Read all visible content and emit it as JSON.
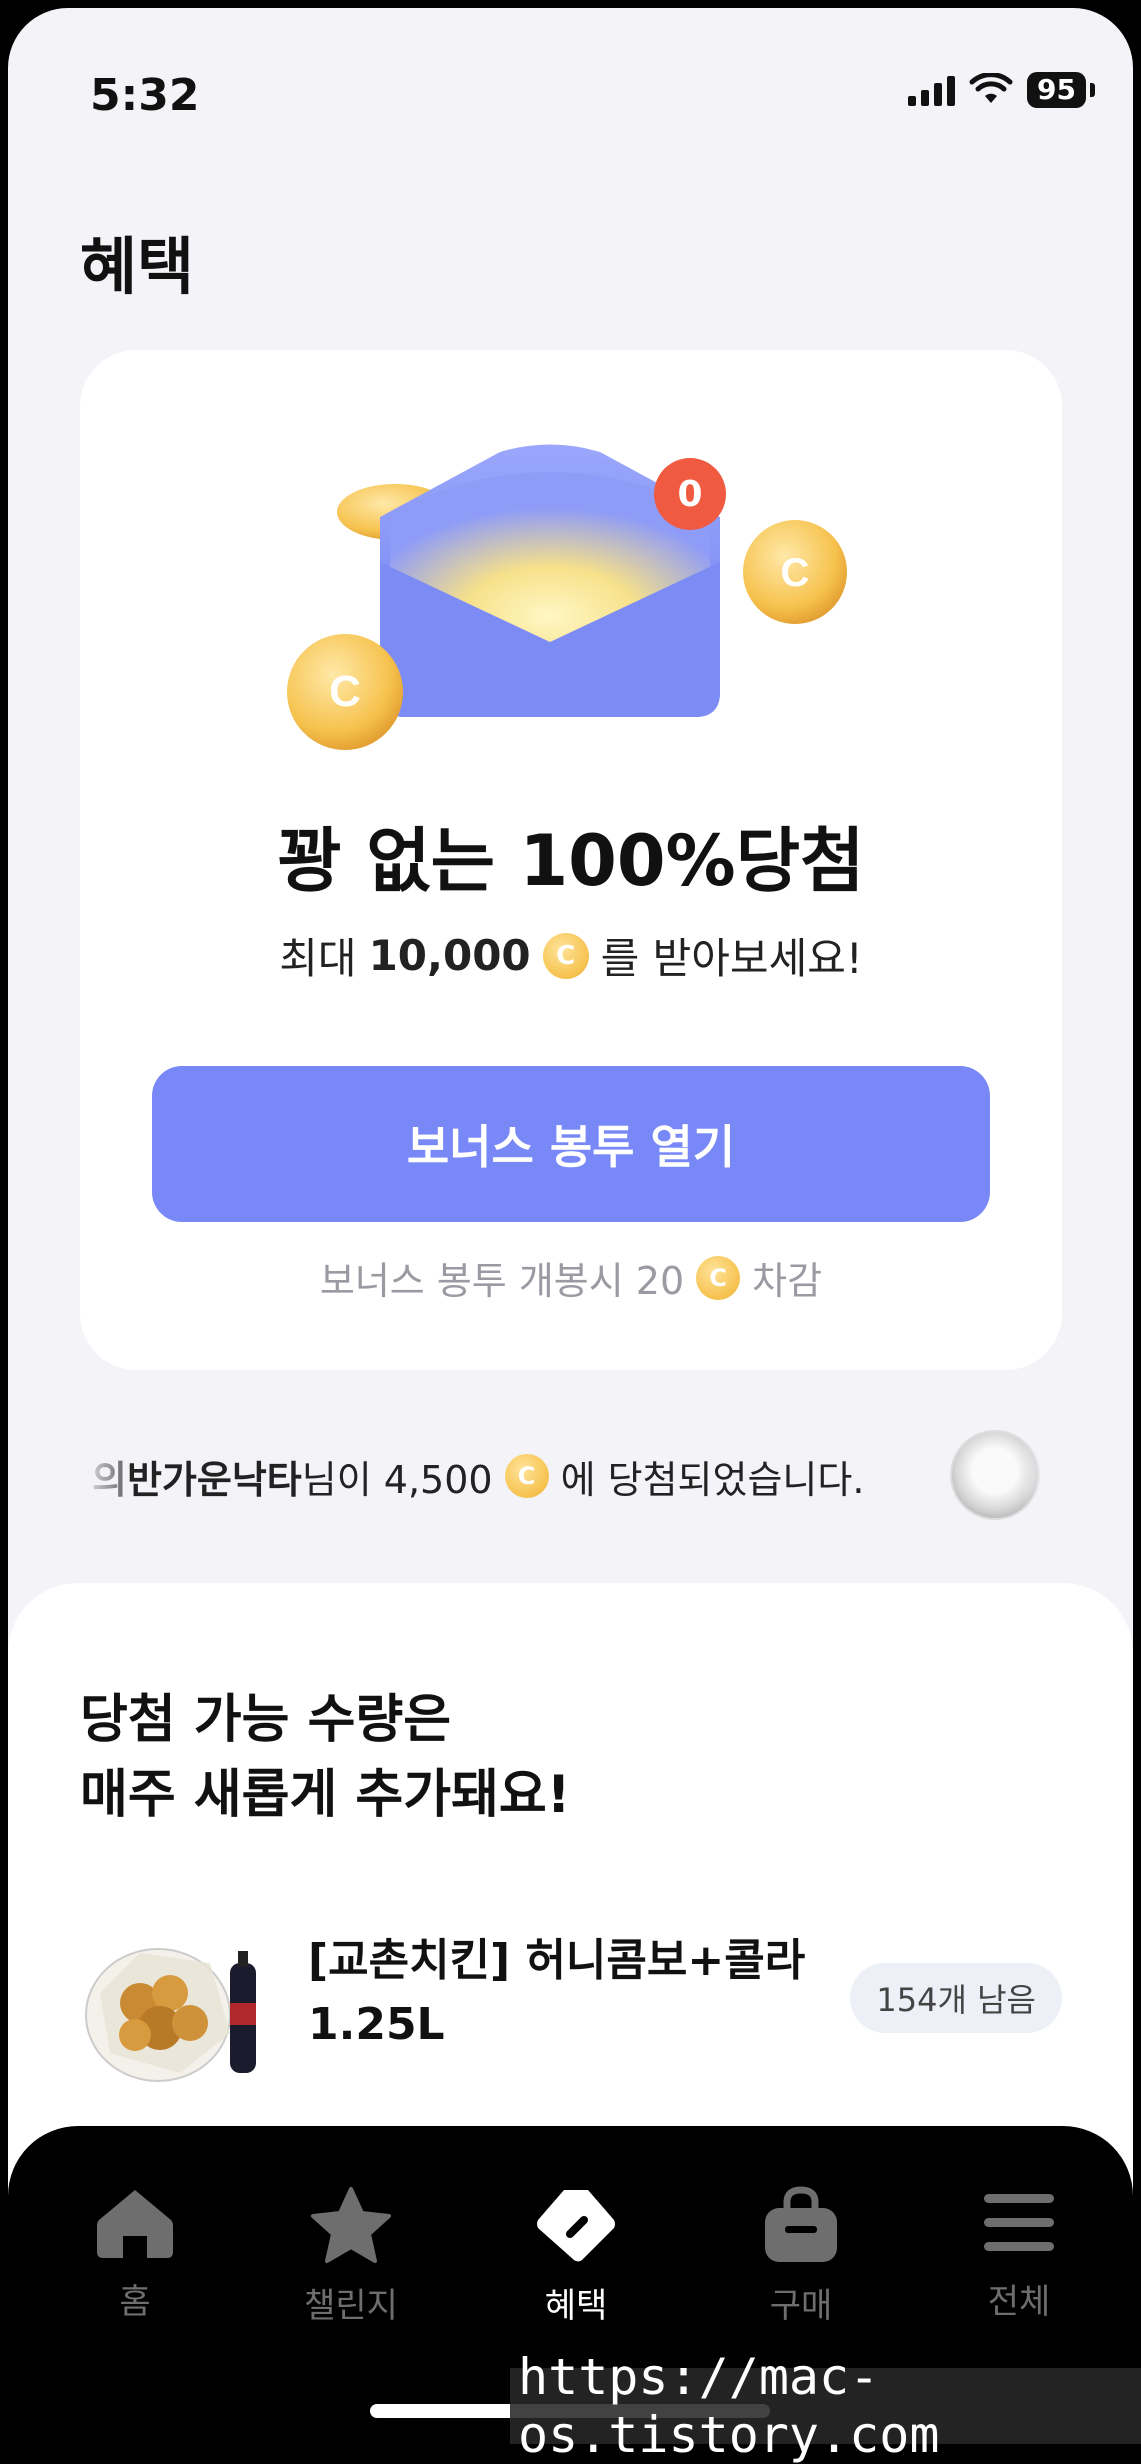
{
  "status_bar": {
    "time": "5:32",
    "battery": "95"
  },
  "page_title": "혜택",
  "bonus_card": {
    "badge_count": "0",
    "title": "꽝 없는 100%당첨",
    "subtitle_prefix": "최대",
    "subtitle_amount": "10,000",
    "subtitle_suffix": "를 받아보세요!",
    "coin_symbol": "C",
    "button_label": "보너스 봉투 열기",
    "cost_note_prefix": "보너스 봉투 개봉시 20",
    "cost_note_suffix": "차감"
  },
  "ticker": {
    "partial_prefix": "의",
    "winner_name": "반가운낙타",
    "message_mid": "님이 4,500",
    "message_end": "에 당첨되었습니다."
  },
  "prizes_section": {
    "heading_line1": "당첨 가능 수량은",
    "heading_line2": "매주 새롭게 추가돼요!",
    "items": [
      {
        "name": "[교촌치킨] 허니콤보+콜라1.25L",
        "remaining": "154개 남음"
      }
    ]
  },
  "tab_bar": {
    "tabs": [
      {
        "label": "홈",
        "icon": "home-icon"
      },
      {
        "label": "챌린지",
        "icon": "star-icon"
      },
      {
        "label": "혜택",
        "icon": "tag-icon",
        "active": true
      },
      {
        "label": "구매",
        "icon": "shopping-bag-icon"
      },
      {
        "label": "전체",
        "icon": "menu-icon"
      }
    ]
  },
  "watermark": "https://mac-os.tistory.com",
  "colors": {
    "accent": "#7889F7",
    "badge": "#EF5A41",
    "coin": "#F6C24E"
  }
}
